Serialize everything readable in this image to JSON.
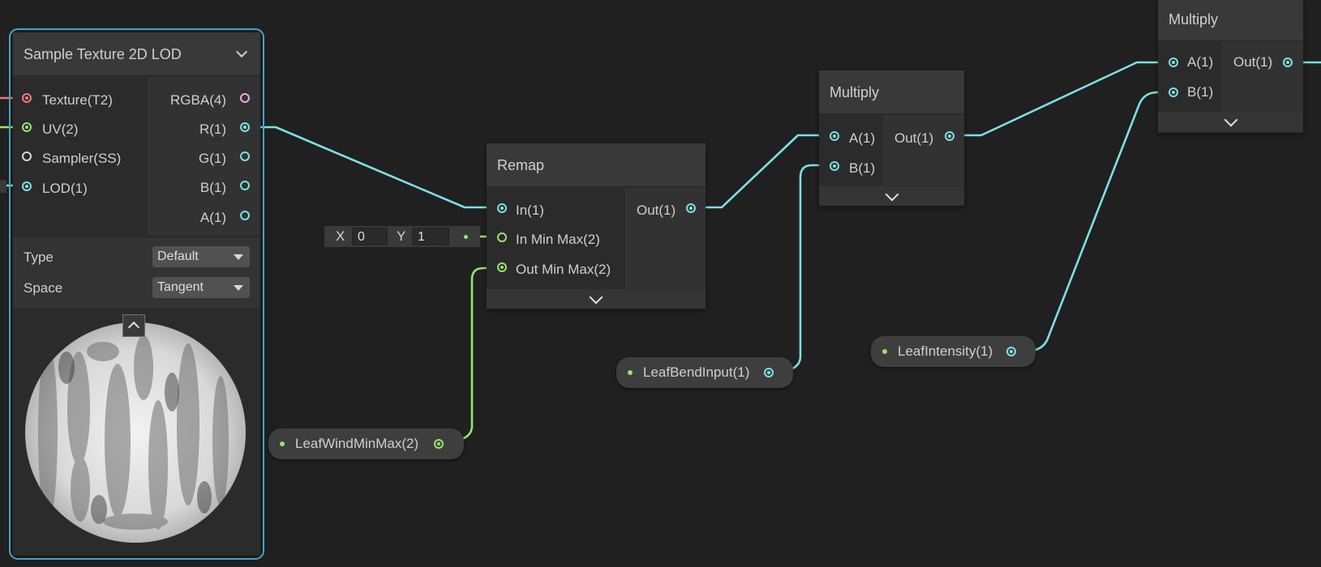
{
  "sample_texture_node": {
    "title": "Sample Texture 2D LOD",
    "inputs": [
      "Texture(T2)",
      "UV(2)",
      "Sampler(SS)",
      "LOD(1)"
    ],
    "outputs": [
      "RGBA(4)",
      "R(1)",
      "G(1)",
      "B(1)",
      "A(1)"
    ],
    "type_label": "Type",
    "type_value": "Default",
    "space_label": "Space",
    "space_value": "Tangent"
  },
  "remap_node": {
    "title": "Remap",
    "inputs": [
      "In(1)",
      "In Min Max(2)",
      "Out Min Max(2)"
    ],
    "output": "Out(1)",
    "x_label": "X",
    "x_value": "0",
    "y_label": "Y",
    "y_value": "1"
  },
  "multiply_node_1": {
    "title": "Multiply",
    "inputs": [
      "A(1)",
      "B(1)"
    ],
    "output": "Out(1)"
  },
  "multiply_node_2": {
    "title": "Multiply",
    "inputs": [
      "A(1)",
      "B(1)"
    ],
    "output": "Out(1)"
  },
  "properties": {
    "leaf_wind": "LeafWindMinMax(2)",
    "leaf_bend": "LeafBendInput(1)",
    "leaf_intensity": "LeafIntensity(1)"
  },
  "colors": {
    "float_port": "#7ce0e4",
    "vector2_port": "#97e36f",
    "texture_port": "#f07878",
    "vector4_port": "#f0a8e0",
    "selection": "#44a3c9",
    "background": "#202020"
  }
}
